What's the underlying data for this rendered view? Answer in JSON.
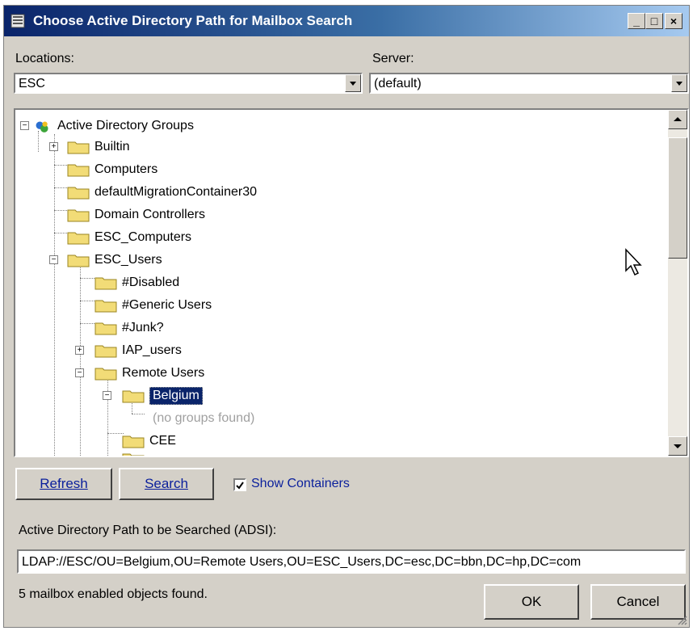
{
  "window": {
    "title": "Choose Active Directory Path for Mailbox Search",
    "controls": {
      "minimize": "_",
      "maximize": "□",
      "close": "×"
    }
  },
  "locations": {
    "label": "Locations:",
    "value": "ESC"
  },
  "server": {
    "label": "Server:",
    "value": "(default)"
  },
  "tree": {
    "root": "Active Directory Groups",
    "items": [
      "Builtin",
      "Computers",
      "defaultMigrationContainer30",
      "Domain Controllers",
      "ESC_Computers",
      "ESC_Users",
      "#Disabled",
      "#Generic Users",
      "#Junk?",
      "IAP_users",
      "Remote Users",
      "Belgium",
      "(no groups found)",
      "CEE"
    ],
    "selected": "Belgium"
  },
  "buttons": {
    "refresh": "Refresh",
    "search": "Search",
    "ok": "OK",
    "cancel": "Cancel"
  },
  "show_containers": {
    "label": "Show Containers",
    "checked": true
  },
  "adsi": {
    "label": "Active Directory Path to be Searched (ADSI):",
    "value": "LDAP://ESC/OU=Belgium,OU=Remote Users,OU=ESC_Users,DC=esc,DC=bbn,DC=hp,DC=com"
  },
  "status": "5 mailbox enabled objects found.",
  "colors": {
    "titlebar_start": "#0a246a",
    "titlebar_end": "#a6caf0",
    "selection": "#0a246a",
    "folder": "#f2dc77",
    "link": "#0a1f9c"
  }
}
